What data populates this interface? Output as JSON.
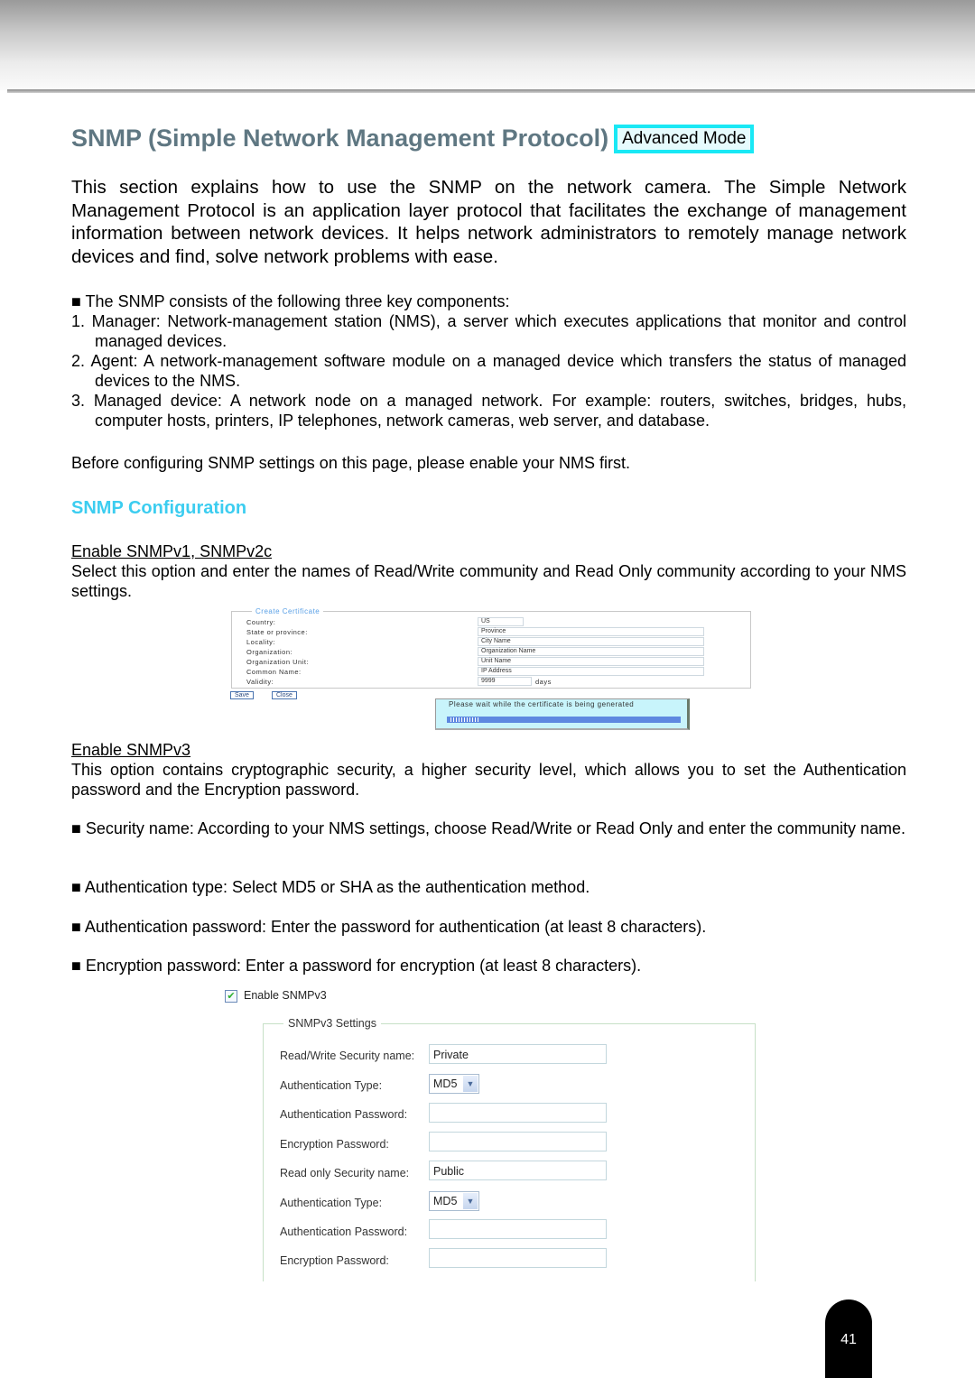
{
  "page": {
    "title": "SNMP (Simple Network Management Protocol)",
    "mode_badge": "Advanced Mode",
    "intro": "This section explains how to use the SNMP on the network camera. The Simple Network Management Protocol is an application layer protocol that facilitates the exchange of management information between network devices. It helps network administrators to remotely manage network devices and find, solve network problems with ease.",
    "components_intro": "■ The SNMP consists of the following three key components:",
    "components": [
      "1. Manager: Network-management station (NMS), a server which executes applications that monitor and control managed devices.",
      "2. Agent: A network-management software module on a managed device which transfers the status of managed devices to the NMS.",
      "3. Managed device: A network node on a managed network. For example: routers, switches, bridges, hubs, computer hosts, printers, IP telephones, network cameras, web server, and database."
    ],
    "before_note": "Before configuring SNMP settings on this page, please enable your NMS first.",
    "section_heading": "SNMP Configuration",
    "v1v2_heading": "Enable SNMPv1, SNMPv2c",
    "v1v2_text": "Select this option and enter the names of Read/Write community and Read Only community according to your NMS settings.",
    "v3_heading": "Enable SNMPv3",
    "v3_text": "This option contains cryptographic security, a higher security level, which allows you to set the Authentication password and the Encryption password.",
    "bullets": [
      "■ Security name: According to your NMS settings, choose Read/Write or Read Only and enter the community name.",
      "■ Authentication type: Select MD5 or SHA as the authentication method.",
      "■ Authentication password: Enter the password for authentication (at least 8 characters).",
      "■ Encryption password: Enter a password for encryption (at least 8 characters)."
    ],
    "page_number": "41"
  },
  "certificate_panel": {
    "legend": "Create Certificate",
    "rows": [
      {
        "label": "Country:",
        "value": "US"
      },
      {
        "label": "State or province:",
        "value": "Province"
      },
      {
        "label": "Locality:",
        "value": "City Name"
      },
      {
        "label": "Organization:",
        "value": "Organization Name"
      },
      {
        "label": "Organization Unit:",
        "value": "Unit Name"
      },
      {
        "label": "Common Name:",
        "value": "IP Address"
      },
      {
        "label": "Validity:",
        "value": "9999",
        "suffix": "days"
      }
    ],
    "save_label": "Save",
    "close_label": "Close",
    "wait_message": "Please wait while the certificate is being generated",
    "progress": 0.12
  },
  "snmpv3_panel": {
    "enable_label": "Enable SNMPv3",
    "enabled": true,
    "legend": "SNMPv3 Settings",
    "fields": [
      {
        "label": "Read/Write Security name:",
        "type": "text",
        "value": "Private"
      },
      {
        "label": "Authentication Type:",
        "type": "select",
        "value": "MD5"
      },
      {
        "label": "Authentication Password:",
        "type": "password",
        "value": ""
      },
      {
        "label": "Encryption Password:",
        "type": "password",
        "value": ""
      },
      {
        "label": "Read only Security name:",
        "type": "text",
        "value": "Public"
      },
      {
        "label": "Authentication Type:",
        "type": "select",
        "value": "MD5"
      },
      {
        "label": "Authentication Password:",
        "type": "password",
        "value": ""
      },
      {
        "label": "Encryption Password:",
        "type": "password",
        "value": ""
      }
    ]
  }
}
